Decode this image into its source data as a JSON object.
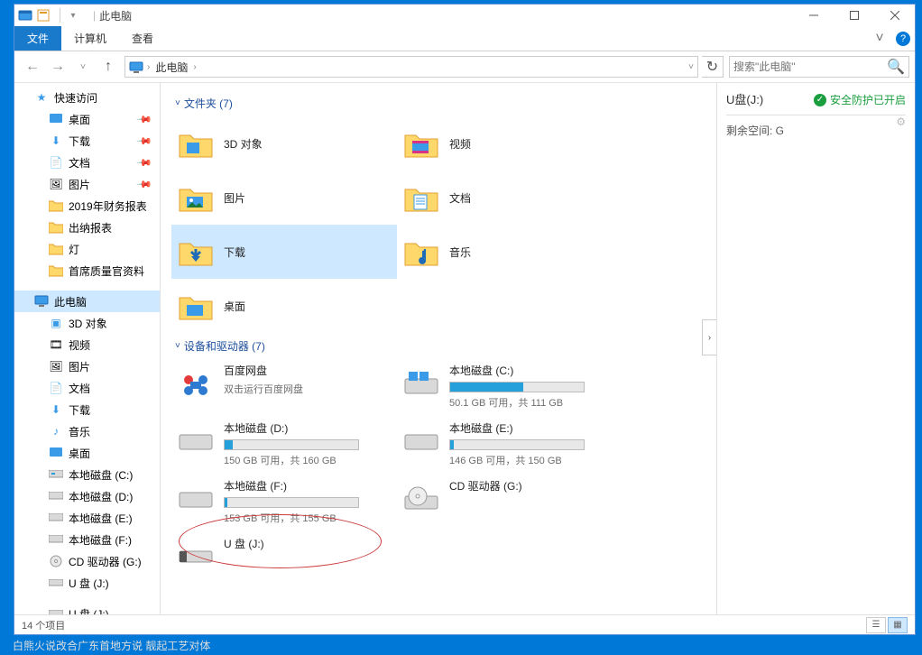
{
  "window": {
    "title": "此电脑"
  },
  "ribbon": {
    "file": "文件",
    "computer": "计算机",
    "view": "查看"
  },
  "address": {
    "crumb": "此电脑",
    "search_placeholder": "搜索\"此电脑\""
  },
  "sidebar": {
    "quick": {
      "label": "快速访问"
    },
    "desktop": {
      "label": "桌面"
    },
    "downloads": {
      "label": "下载"
    },
    "documents": {
      "label": "文档"
    },
    "pictures": {
      "label": "图片"
    },
    "fin2019": {
      "label": "2019年财务报表"
    },
    "cashier": {
      "label": "出纳报表"
    },
    "deng": {
      "label": "灯"
    },
    "chief": {
      "label": "首席质量官资料"
    },
    "thispc": {
      "label": "此电脑"
    },
    "objects3d": {
      "label": "3D 对象"
    },
    "videos": {
      "label": "视频"
    },
    "pictures2": {
      "label": "图片"
    },
    "documents2": {
      "label": "文档"
    },
    "downloads2": {
      "label": "下载"
    },
    "music": {
      "label": "音乐"
    },
    "desktop2": {
      "label": "桌面"
    },
    "diskC": {
      "label": "本地磁盘 (C:)"
    },
    "diskD": {
      "label": "本地磁盘 (D:)"
    },
    "diskE": {
      "label": "本地磁盘 (E:)"
    },
    "diskF": {
      "label": "本地磁盘 (F:)"
    },
    "cdG": {
      "label": "CD 驱动器 (G:)"
    },
    "usbJ": {
      "label": "U 盘 (J:)"
    },
    "usbJ2": {
      "label": "U 盘 (J:)"
    }
  },
  "groups": {
    "folders": {
      "header": "文件夹 (7)"
    },
    "drives": {
      "header": "设备和驱动器 (7)"
    }
  },
  "folders": {
    "objects3d": "3D 对象",
    "videos": "视频",
    "pictures": "图片",
    "documents": "文档",
    "downloads": "下载",
    "music": "音乐",
    "desktop": "桌面"
  },
  "drives": {
    "baidu": {
      "name": "百度网盘",
      "sub": "双击运行百度网盘"
    },
    "c": {
      "name": "本地磁盘 (C:)",
      "info": "50.1 GB 可用，共 111 GB",
      "fill": 55
    },
    "d": {
      "name": "本地磁盘 (D:)",
      "info": "150 GB 可用，共 160 GB",
      "fill": 6
    },
    "e": {
      "name": "本地磁盘 (E:)",
      "info": "146 GB 可用，共 150 GB",
      "fill": 3
    },
    "f": {
      "name": "本地磁盘 (F:)",
      "info": "153 GB 可用，共 155 GB",
      "fill": 2
    },
    "cd": {
      "name": "CD 驱动器 (G:)"
    },
    "usb": {
      "name": "U 盘 (J:)"
    }
  },
  "details": {
    "title": "U盘(J:)",
    "protect": "安全防护已开启",
    "space": "剩余空间: G"
  },
  "status": {
    "items": "14 个项目"
  },
  "bottom": "白熊火说改合广东首地方说 靓起工艺对体"
}
